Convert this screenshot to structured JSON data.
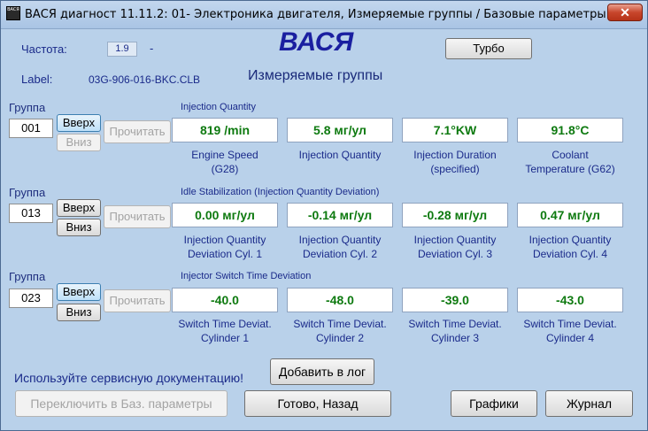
{
  "window": {
    "title": "ВАСЯ диагност 11.11.2: 01- Электроника двигателя,  Измеряемые группы / Базовые параметры",
    "icon_text": "ВАСЯ",
    "close_label": "✕"
  },
  "header": {
    "freq_label": "Частота:",
    "freq_value": "1.9",
    "freq_dash": "-",
    "brand": "ВАСЯ",
    "turbo_label": "Турбо",
    "label_caption": "Label:",
    "label_value": "03G-906-016-BKC.CLB",
    "subtitle": "Измеряемые группы"
  },
  "groups": [
    {
      "caption": "Группа",
      "number": "001",
      "up_label": "Вверх",
      "down_label": "Вниз",
      "read_label": "Прочитать",
      "title": "Injection Quantity",
      "values": [
        "819 /min",
        "5.8 мг/ул",
        "7.1°KW",
        "91.8°C"
      ],
      "captions": [
        [
          "Engine Speed",
          "(G28)"
        ],
        [
          "Injection Quantity",
          ""
        ],
        [
          "Injection Duration",
          "(specified)"
        ],
        [
          "Coolant",
          "Temperature (G62)"
        ]
      ]
    },
    {
      "caption": "Группа",
      "number": "013",
      "up_label": "Вверх",
      "down_label": "Вниз",
      "read_label": "Прочитать",
      "title": "Idle Stabilization (Injection Quantity Deviation)",
      "values": [
        "0.00 мг/ул",
        "-0.14 мг/ул",
        "-0.28 мг/ул",
        "0.47 мг/ул"
      ],
      "captions": [
        [
          "Injection Quantity",
          "Deviation Cyl. 1"
        ],
        [
          "Injection Quantity",
          "Deviation Cyl. 2"
        ],
        [
          "Injection Quantity",
          "Deviation Cyl. 3"
        ],
        [
          "Injection Quantity",
          "Deviation Cyl. 4"
        ]
      ]
    },
    {
      "caption": "Группа",
      "number": "023",
      "up_label": "Вверх",
      "down_label": "Вниз",
      "read_label": "Прочитать",
      "title": "Injector Switch Time Deviation",
      "values": [
        "-40.0",
        "-48.0",
        "-39.0",
        "-43.0"
      ],
      "captions": [
        [
          "Switch Time Deviat.",
          "Cylinder 1"
        ],
        [
          "Switch Time Deviat.",
          "Cylinder 2"
        ],
        [
          "Switch Time Deviat.",
          "Cylinder 3"
        ],
        [
          "Switch Time Deviat.",
          "Cylinder 4"
        ]
      ]
    }
  ],
  "footer": {
    "notice": "Используйте сервисную документацию!",
    "add_log_label": "Добавить в лог",
    "switch_label": "Переключить в Баз. параметры",
    "done_label": "Готово, Назад",
    "charts_label": "Графики",
    "journal_label": "Журнал"
  },
  "colors": {
    "background": "#b9d1ea",
    "value_text": "#0e7a10",
    "label_text": "#1a2a8a",
    "brand": "#1a1fa0"
  }
}
